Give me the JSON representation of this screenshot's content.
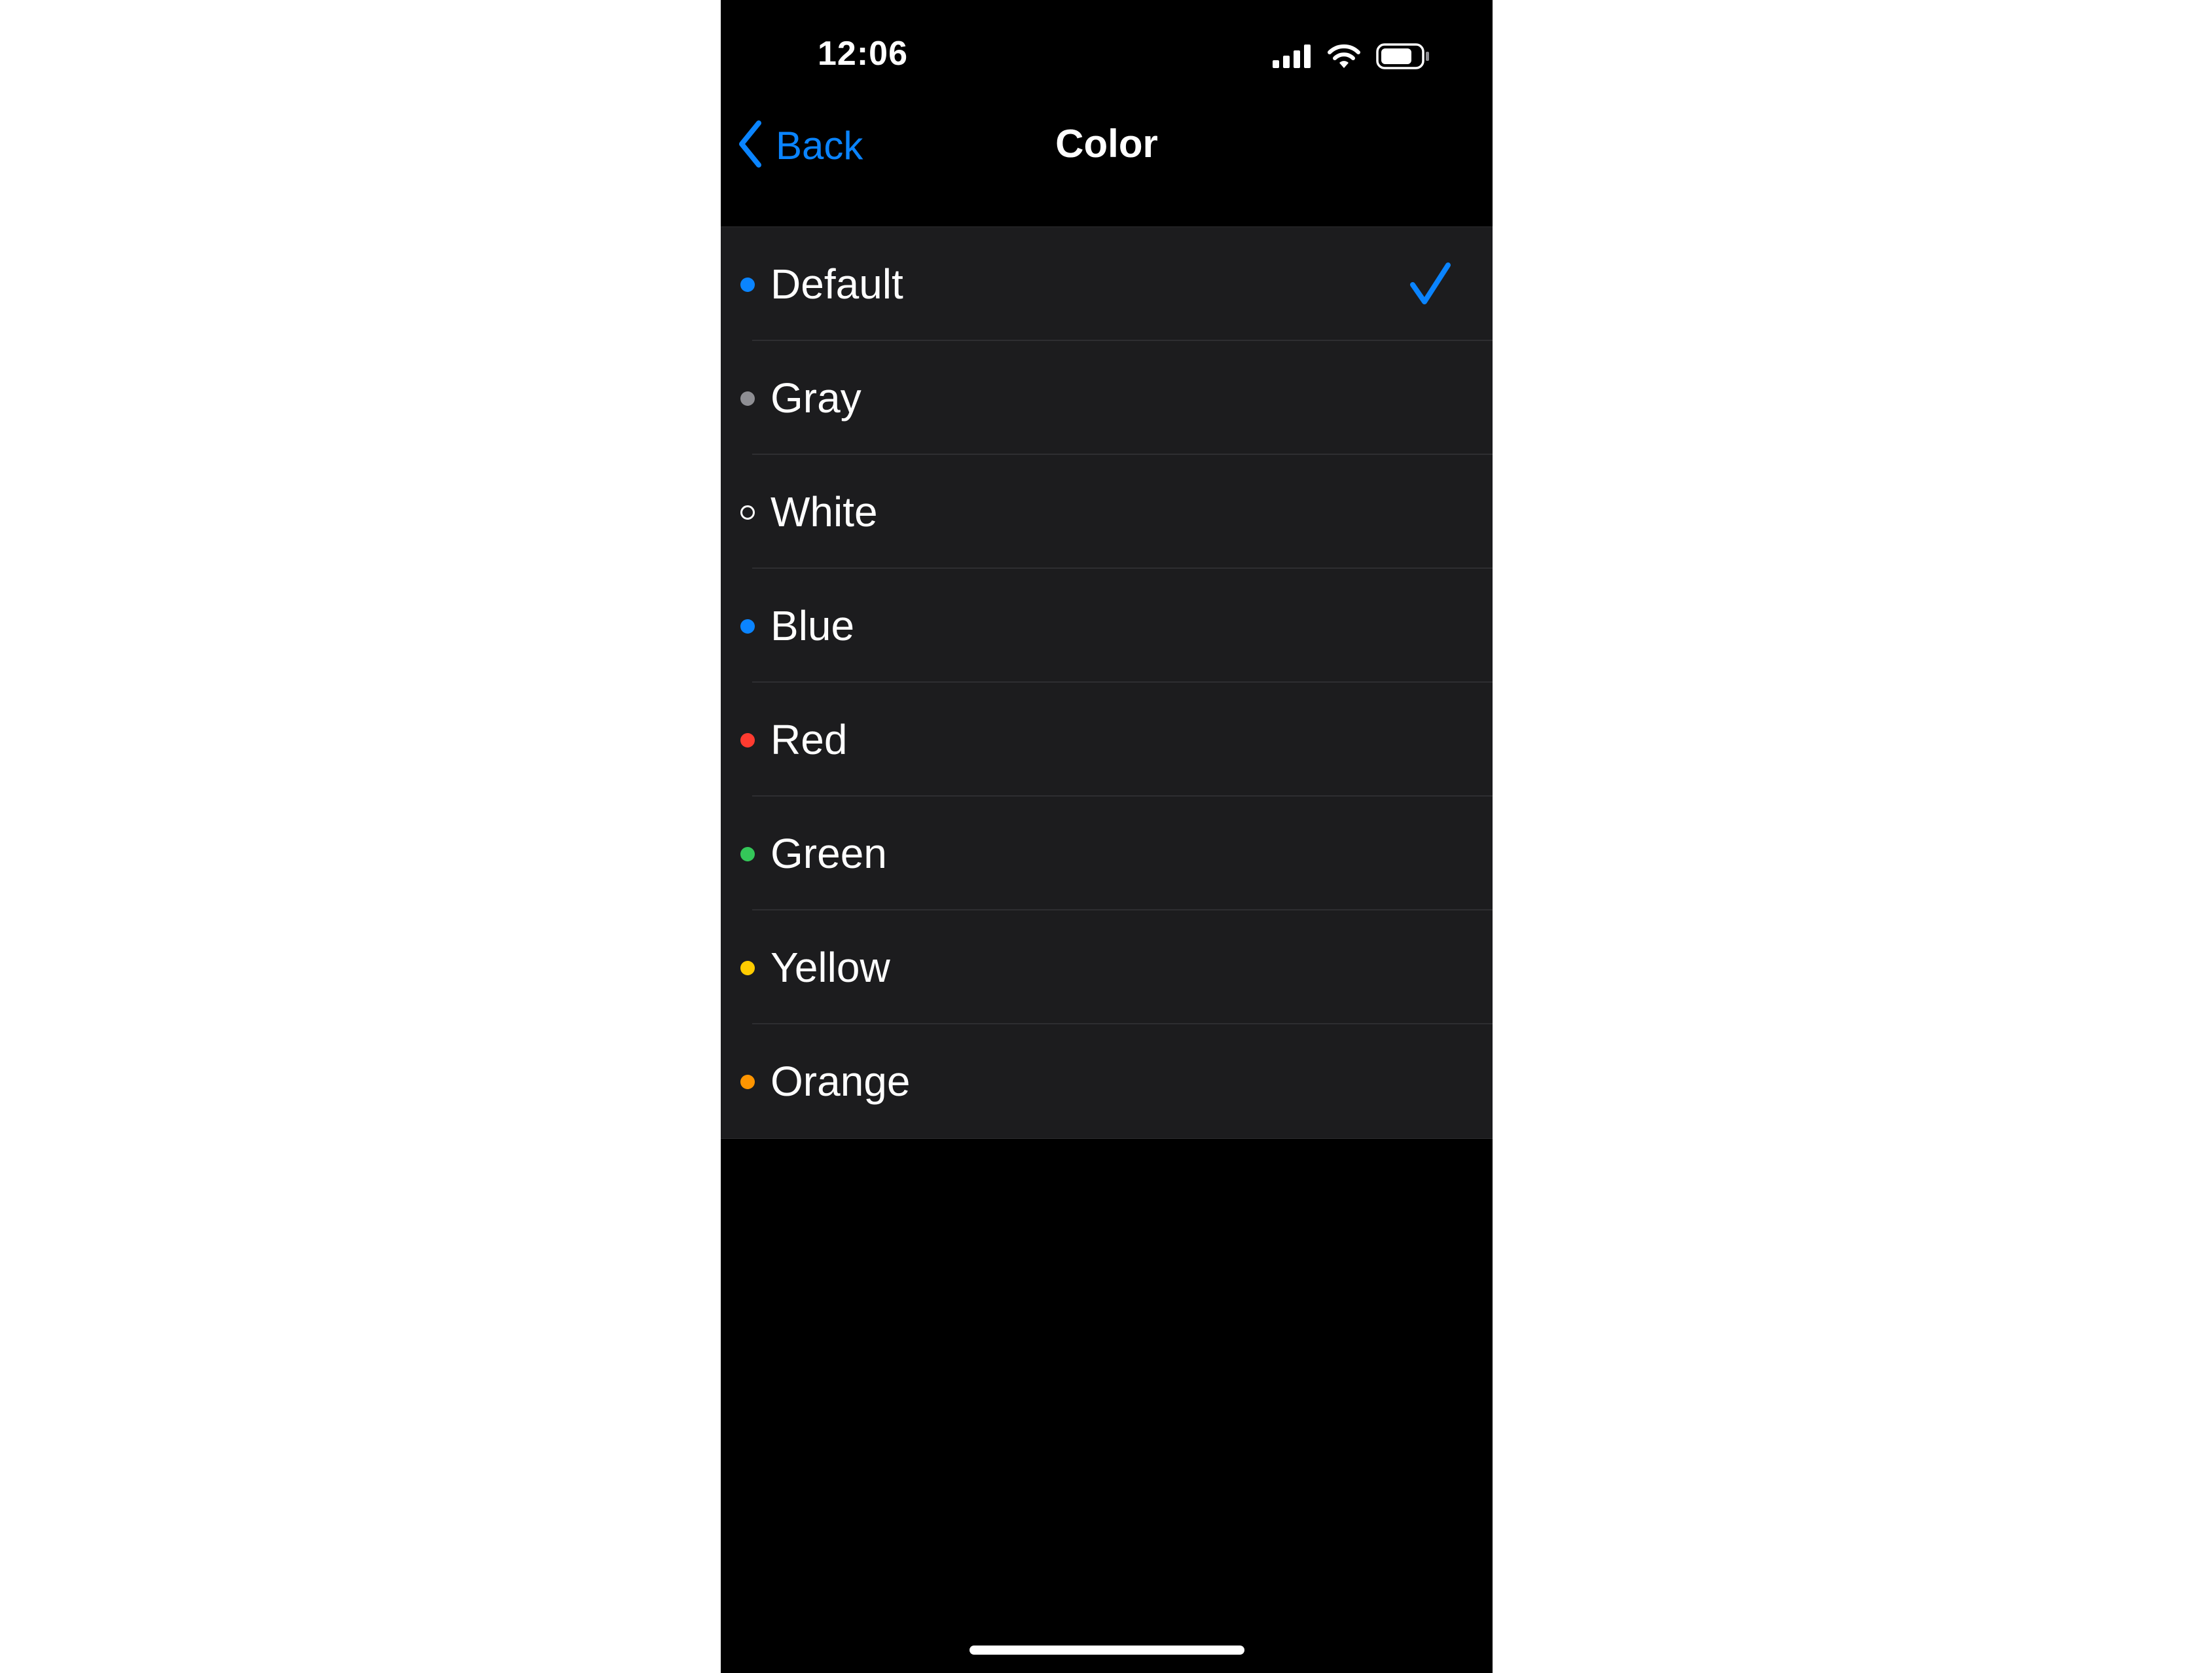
{
  "status_bar": {
    "time": "12:06",
    "icons": [
      "cellular-signal-icon",
      "wifi-icon",
      "battery-icon"
    ]
  },
  "nav": {
    "back_label": "Back",
    "title": "Color"
  },
  "colors": {
    "accent": "#0a84ff",
    "background": "#000000",
    "row_background": "#1c1c1e",
    "separator": "#2e2e31"
  },
  "options": [
    {
      "label": "Default",
      "dot_color": "#0a84ff",
      "selected": true
    },
    {
      "label": "Gray",
      "dot_color": "#8e8e93",
      "selected": false
    },
    {
      "label": "White",
      "dot_color": "#ffffff",
      "selected": false,
      "outline": true
    },
    {
      "label": "Blue",
      "dot_color": "#0a84ff",
      "selected": false
    },
    {
      "label": "Red",
      "dot_color": "#ff3b30",
      "selected": false
    },
    {
      "label": "Green",
      "dot_color": "#34c759",
      "selected": false
    },
    {
      "label": "Yellow",
      "dot_color": "#ffcc00",
      "selected": false
    },
    {
      "label": "Orange",
      "dot_color": "#ff9500",
      "selected": false
    }
  ]
}
